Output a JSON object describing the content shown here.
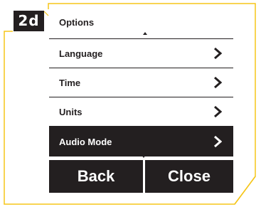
{
  "step_label": "2d",
  "screen": {
    "title": "Options",
    "items": [
      {
        "label": "Language",
        "icon": "chevron-right-icon"
      },
      {
        "label": "Time",
        "icon": "chevron-right-icon"
      },
      {
        "label": "Units",
        "icon": "chevron-right-icon"
      },
      {
        "label": "Audio Mode",
        "icon": "chevron-right-icon",
        "selected": true
      }
    ],
    "buttons": {
      "back_label": "Back",
      "close_label": "Close"
    }
  },
  "colors": {
    "frame": "#f5c518",
    "dark": "#231f20",
    "background": "#ffffff"
  }
}
